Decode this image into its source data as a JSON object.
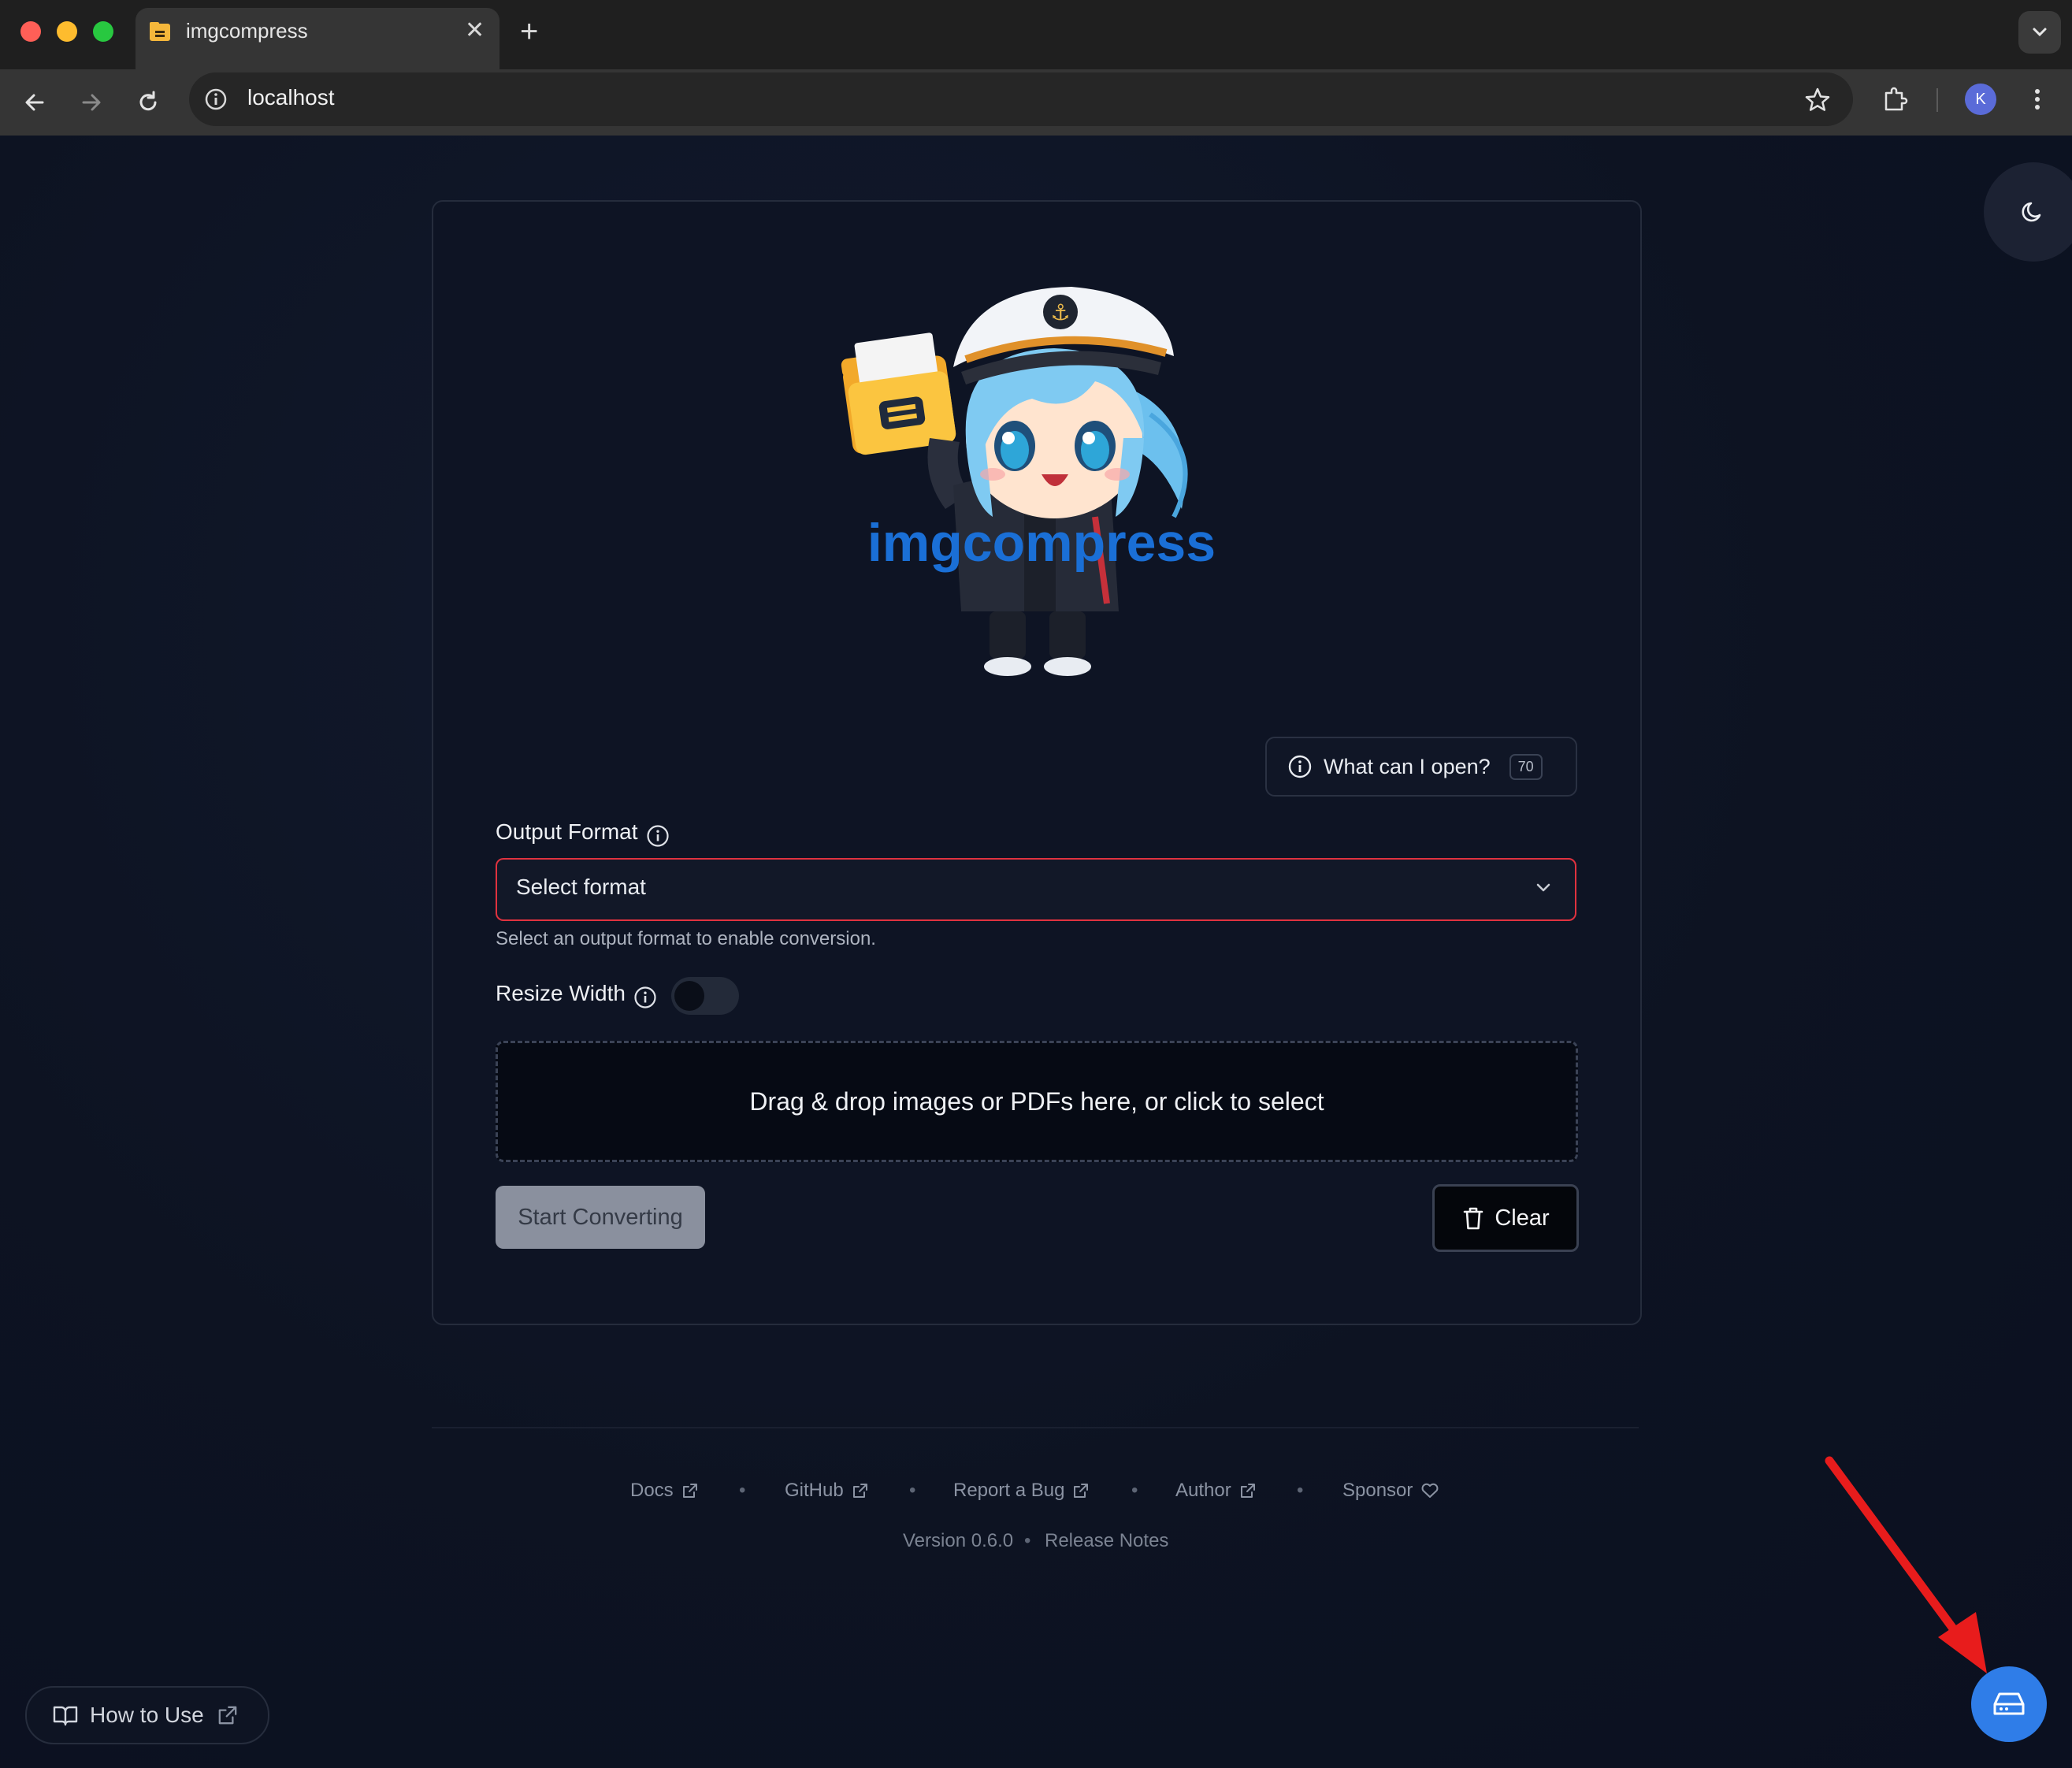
{
  "browser": {
    "tab_title": "imgcompress",
    "tab_close": "✕",
    "new_tab": "+",
    "url": "localhost",
    "profile_initial": "K"
  },
  "app": {
    "logo_text": "imgcompress",
    "what_can_i_open": {
      "label": "What can I open?",
      "count": "70"
    },
    "output_format": {
      "label": "Output Format",
      "placeholder": "Select format",
      "helper": "Select an output format to enable conversion."
    },
    "resize_width": {
      "label": "Resize Width",
      "enabled": false
    },
    "dropzone": {
      "text": "Drag & drop images or PDFs here, or click to select"
    },
    "buttons": {
      "start": "Start Converting",
      "clear": "Clear"
    }
  },
  "footer": {
    "links": [
      "Docs",
      "GitHub",
      "Report a Bug",
      "Author",
      "Sponsor"
    ],
    "separator": "•",
    "version": "Version 0.6.0",
    "release_notes": "Release Notes"
  },
  "how_to_use": {
    "label": "How to Use"
  },
  "colors": {
    "accent_blue": "#2f7de8",
    "logo_blue": "#1a6fd6",
    "error_border": "#e0323f",
    "annotation_arrow": "#e81c1c"
  }
}
